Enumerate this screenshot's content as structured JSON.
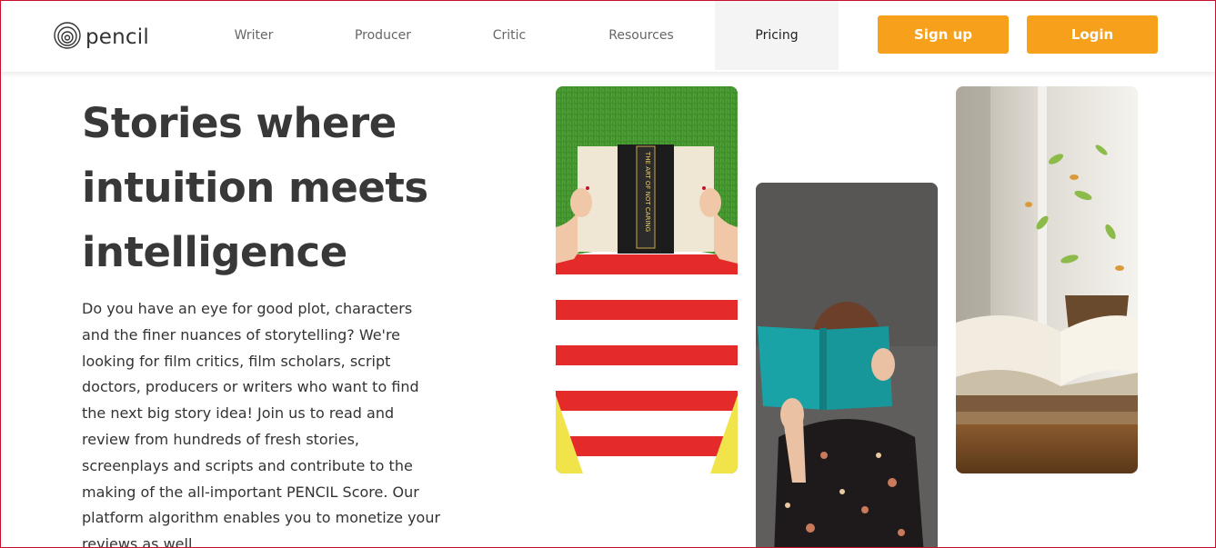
{
  "brand": {
    "name": "pencil"
  },
  "nav": {
    "items": [
      {
        "label": "Writer"
      },
      {
        "label": "Producer"
      },
      {
        "label": "Critic"
      },
      {
        "label": "Resources"
      },
      {
        "label": "Pricing",
        "active": true
      }
    ]
  },
  "auth": {
    "signup_label": "Sign up",
    "login_label": "Login"
  },
  "hero": {
    "headline_lines": [
      "Stories where",
      "intuition meets",
      "intelligence"
    ],
    "intro_lines": [
      "Do you have an eye for good plot, characters",
      "and the finer nuances of storytelling? We're",
      "looking for film critics, film scholars, script",
      "doctors, producers or writers who want to find",
      "the next big story idea! Join us to read and",
      "review from hundreds of fresh stories,",
      "screenplays and scripts and contribute to the",
      "making of the all-important PENCIL Score. Our",
      "platform algorithm enables you to monetize your",
      "reviews as well."
    ]
  },
  "images": {
    "photo1": {
      "book_title": "THE ART OF NOT CARING"
    }
  },
  "colors": {
    "accent": "#f7a01c",
    "headline": "#383838",
    "nav_text": "#666666",
    "active_bg": "#f4f4f4",
    "frame_border": "#c8102e"
  }
}
